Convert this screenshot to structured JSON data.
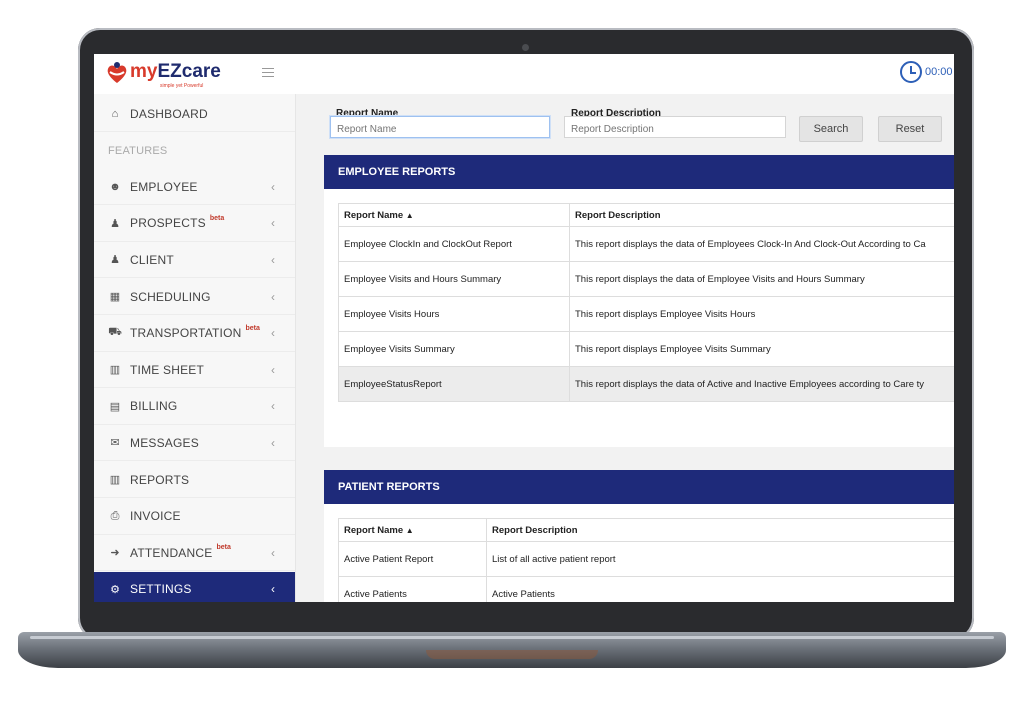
{
  "app": {
    "logo_text_prefix": "my",
    "logo_text_brand": "EZcare",
    "logo_tagline": "simple yet Powerful",
    "timer": "00:00"
  },
  "sidebar": {
    "items": [
      {
        "label": "DASHBOARD",
        "icon": "home-icon",
        "chevron": false,
        "beta": false
      },
      {
        "label": "FEATURES",
        "section": true
      },
      {
        "label": "EMPLOYEE",
        "icon": "users-icon",
        "chevron": true,
        "beta": false
      },
      {
        "label": "PROSPECTS",
        "icon": "user-icon",
        "chevron": true,
        "beta": true
      },
      {
        "label": "CLIENT",
        "icon": "user-icon",
        "chevron": true,
        "beta": false
      },
      {
        "label": "SCHEDULING",
        "icon": "calendar-icon",
        "chevron": true,
        "beta": false
      },
      {
        "label": "TRANSPORTATION",
        "icon": "truck-icon",
        "chevron": true,
        "beta": true
      },
      {
        "label": "TIME SHEET",
        "icon": "bar-chart-icon",
        "chevron": true,
        "beta": false
      },
      {
        "label": "BILLING",
        "icon": "document-icon",
        "chevron": true,
        "beta": false
      },
      {
        "label": "MESSAGES",
        "icon": "envelope-icon",
        "chevron": true,
        "beta": false
      },
      {
        "label": "REPORTS",
        "icon": "bar-chart-icon",
        "chevron": false,
        "beta": false
      },
      {
        "label": "INVOICE",
        "icon": "invoice-icon",
        "chevron": false,
        "beta": false
      },
      {
        "label": "ATTENDANCE",
        "icon": "sign-in-icon",
        "chevron": true,
        "beta": true
      },
      {
        "label": "SETTINGS",
        "icon": "gear-icon",
        "chevron": true,
        "beta": false,
        "active": true
      }
    ],
    "beta_label": "beta",
    "chevron_glyph": "‹"
  },
  "filters": {
    "name_label": "Report Name",
    "name_placeholder": "Report Name",
    "desc_label": "Report Description",
    "desc_placeholder": "Report Description",
    "search_label": "Search",
    "reset_label": "Reset"
  },
  "employee_reports": {
    "title": "EMPLOYEE REPORTS",
    "col_name": "Report Name",
    "col_desc": "Report Description",
    "sort_glyph": "▲",
    "rows": [
      {
        "name": "Employee ClockIn and ClockOut Report",
        "desc": "This report displays the data of Employees Clock-In And Clock-Out According to Ca"
      },
      {
        "name": "Employee Visits and Hours Summary",
        "desc": "This report displays the data of Employee Visits and Hours Summary"
      },
      {
        "name": "Employee Visits Hours",
        "desc": "This report displays Employee Visits Hours"
      },
      {
        "name": "Employee Visits Summary",
        "desc": "This report displays Employee Visits Summary"
      },
      {
        "name": "EmployeeStatusReport",
        "desc": "This report displays the data of Active and Inactive Employees according to Care ty"
      }
    ]
  },
  "patient_reports": {
    "title": "PATIENT REPORTS",
    "col_name": "Report Name",
    "col_desc": "Report Description",
    "sort_glyph": "▲",
    "rows": [
      {
        "name": "Active Patient Report",
        "desc": "List of all active patient report"
      },
      {
        "name": "Active Patients",
        "desc": "Active Patients"
      }
    ]
  },
  "colors": {
    "brand_navy": "#1e2a7a",
    "brand_red": "#d83a2b",
    "timer_blue": "#2d5fb7"
  }
}
